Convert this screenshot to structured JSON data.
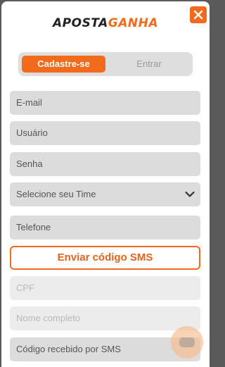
{
  "brand": {
    "part1": "APOSTA",
    "part2": "GANHA",
    "accent_color": "#f26b1d"
  },
  "close": {
    "icon": "close-icon"
  },
  "tabs": {
    "register_label": "Cadastre-se",
    "login_label": "Entrar",
    "active": "Cadastre-se"
  },
  "form": {
    "email_placeholder": "E-mail",
    "username_placeholder": "Usuário",
    "password_placeholder": "Senha",
    "team_select": "Selecione seu Time",
    "phone_placeholder": "Telefone",
    "sms_button": "Enviar código SMS",
    "cpf_placeholder": "CPF",
    "fullname_placeholder": "Nome completo",
    "sms_code_placeholder": "Código recebido por SMS"
  },
  "chat": {
    "icon": "chat-icon"
  }
}
